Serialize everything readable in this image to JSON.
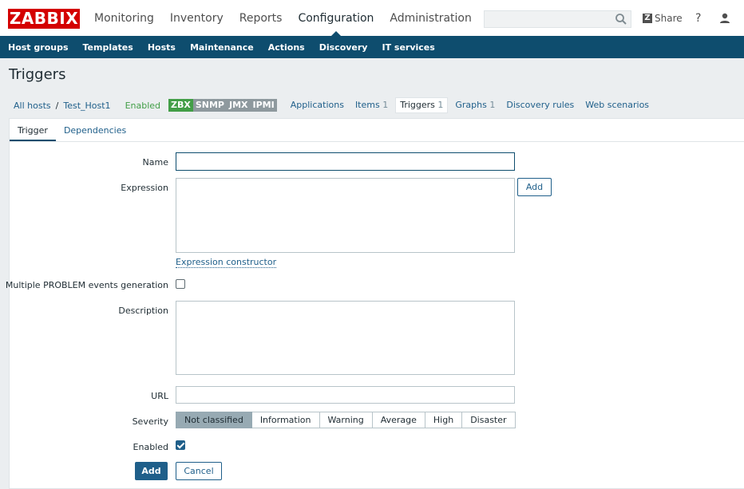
{
  "brand": {
    "logo": "ZABBIX",
    "color": "#d40000"
  },
  "top_nav": [
    {
      "label": "Monitoring"
    },
    {
      "label": "Inventory"
    },
    {
      "label": "Reports"
    },
    {
      "label": "Configuration",
      "active": true
    },
    {
      "label": "Administration"
    }
  ],
  "search": {
    "value": "",
    "placeholder": ""
  },
  "header_actions": {
    "share_label": "Share",
    "help_label": "?"
  },
  "sub_nav": [
    {
      "label": "Host groups"
    },
    {
      "label": "Templates"
    },
    {
      "label": "Hosts",
      "active": true
    },
    {
      "label": "Maintenance"
    },
    {
      "label": "Actions"
    },
    {
      "label": "Discovery"
    },
    {
      "label": "IT services"
    }
  ],
  "page": {
    "title": "Triggers"
  },
  "host_nav": {
    "all_hosts": "All hosts",
    "separator": "/",
    "host": "Test_Host1",
    "status": "Enabled",
    "badges": [
      "ZBX",
      "SNMP",
      "JMX",
      "IPMI"
    ],
    "applications": "Applications",
    "items": "Items",
    "items_count": "1",
    "triggers": "Triggers",
    "triggers_count": "1",
    "graphs": "Graphs",
    "graphs_count": "1",
    "discovery_rules": "Discovery rules",
    "web_scenarios": "Web scenarios"
  },
  "form_tabs": {
    "trigger": "Trigger",
    "dependencies": "Dependencies"
  },
  "form": {
    "name_label": "Name",
    "name_value": "",
    "expression_label": "Expression",
    "expression_value": "",
    "expression_add": "Add",
    "expression_constructor": "Expression constructor",
    "multiple_label": "Multiple PROBLEM events generation",
    "multiple_checked": false,
    "description_label": "Description",
    "description_value": "",
    "url_label": "URL",
    "url_value": "",
    "severity_label": "Severity",
    "severities": [
      "Not classified",
      "Information",
      "Warning",
      "Average",
      "High",
      "Disaster"
    ],
    "severity_selected": "Not classified",
    "enabled_label": "Enabled",
    "enabled_checked": true,
    "submit_label": "Add",
    "cancel_label": "Cancel"
  },
  "colors": {
    "nav_bar": "#0e4d6e",
    "link": "#1f5f8a",
    "enabled_green": "#429e47",
    "badge_grey": "#8e999e",
    "severity_active": "#97aab3"
  }
}
